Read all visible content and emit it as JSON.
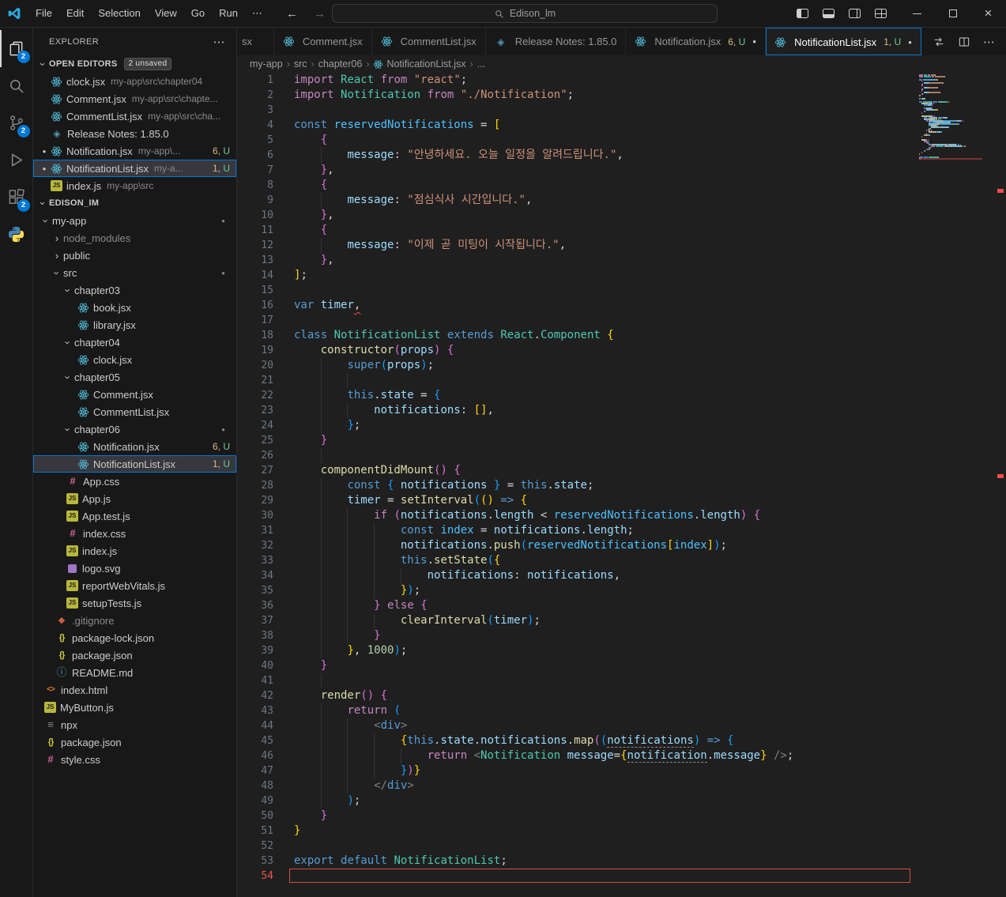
{
  "palette": {
    "accent": "#0078d4",
    "badge": "#0078d4",
    "error": "#f14c4c",
    "untracked": "#73c991",
    "problems": "#d7ba7d"
  },
  "titlebar": {
    "menus": [
      "File",
      "Edit",
      "Selection",
      "View",
      "Go",
      "Run",
      "⋯"
    ],
    "back_arrow": "←",
    "forward_arrow": "→",
    "command_center": "Edison_lm",
    "layout_controls": [
      "toggle-primary-sidebar",
      "toggle-panel",
      "toggle-secondary-sidebar",
      "customize-layout"
    ],
    "window_controls": [
      "minimize",
      "maximize",
      "close"
    ]
  },
  "activity_bar": [
    {
      "name": "explorer",
      "badge": "2",
      "active": true
    },
    {
      "name": "search"
    },
    {
      "name": "source-control",
      "badge": "2"
    },
    {
      "name": "run-debug"
    },
    {
      "name": "extensions",
      "badge": "2"
    },
    {
      "name": "python"
    }
  ],
  "sidebar": {
    "title": "EXPLORER",
    "more": "⋯",
    "open_editors": {
      "label": "OPEN EDITORS",
      "badge": "2 unsaved",
      "items": [
        {
          "icon": "react",
          "label": "clock.jsx",
          "desc": "my-app\\src\\chapter04"
        },
        {
          "icon": "react",
          "label": "Comment.jsx",
          "desc": "my-app\\src\\chapte..."
        },
        {
          "icon": "react",
          "label": "CommentList.jsx",
          "desc": "my-app\\src\\cha..."
        },
        {
          "icon": "notes",
          "label": "Release Notes: 1.85.0"
        },
        {
          "icon": "react",
          "label": "Notification.jsx",
          "desc": "my-app\\...",
          "badge": "6, U",
          "modified": true
        },
        {
          "icon": "react",
          "label": "NotificationList.jsx",
          "desc": "my-a...",
          "badge": "1, U",
          "modified": true,
          "selected": true
        },
        {
          "icon": "js",
          "label": "index.js",
          "desc": "my-app\\src"
        }
      ]
    },
    "workspace": {
      "label": "EDISON_IM",
      "items": [
        {
          "depth": 0,
          "type": "folder",
          "expanded": true,
          "label": "my-app",
          "dot": true
        },
        {
          "depth": 1,
          "type": "folder",
          "label": "node_modules",
          "dim": true
        },
        {
          "depth": 1,
          "type": "folder",
          "label": "public"
        },
        {
          "depth": 1,
          "type": "folder",
          "expanded": true,
          "label": "src",
          "dot": true
        },
        {
          "depth": 2,
          "type": "folder",
          "expanded": true,
          "label": "chapter03"
        },
        {
          "depth": 3,
          "icon": "react",
          "label": "book.jsx"
        },
        {
          "depth": 3,
          "icon": "react",
          "label": "library.jsx"
        },
        {
          "depth": 2,
          "type": "folder",
          "expanded": true,
          "label": "chapter04"
        },
        {
          "depth": 3,
          "icon": "react",
          "label": "clock.jsx"
        },
        {
          "depth": 2,
          "type": "folder",
          "expanded": true,
          "label": "chapter05"
        },
        {
          "depth": 3,
          "icon": "react",
          "label": "Comment.jsx"
        },
        {
          "depth": 3,
          "icon": "react",
          "label": "CommentList.jsx"
        },
        {
          "depth": 2,
          "type": "folder",
          "expanded": true,
          "label": "chapter06",
          "dot": true
        },
        {
          "depth": 3,
          "icon": "react",
          "label": "Notification.jsx",
          "badge": "6, U"
        },
        {
          "depth": 3,
          "icon": "react",
          "label": "NotificationList.jsx",
          "badge": "1, U",
          "selected": true
        },
        {
          "depth": 2,
          "icon": "css",
          "label": "App.css"
        },
        {
          "depth": 2,
          "icon": "js",
          "label": "App.js"
        },
        {
          "depth": 2,
          "icon": "js",
          "label": "App.test.js"
        },
        {
          "depth": 2,
          "icon": "css",
          "label": "index.css"
        },
        {
          "depth": 2,
          "icon": "js",
          "label": "index.js"
        },
        {
          "depth": 2,
          "icon": "svgf",
          "label": "logo.svg"
        },
        {
          "depth": 2,
          "icon": "js",
          "label": "reportWebVitals.js"
        },
        {
          "depth": 2,
          "icon": "js",
          "label": "setupTests.js"
        },
        {
          "depth": 1,
          "icon": "git",
          "label": ".gitignore",
          "dim": true
        },
        {
          "depth": 1,
          "icon": "json",
          "label": "package-lock.json"
        },
        {
          "depth": 1,
          "icon": "json",
          "label": "package.json"
        },
        {
          "depth": 1,
          "icon": "md",
          "label": "README.md"
        },
        {
          "depth": 0,
          "icon": "html",
          "label": "index.html"
        },
        {
          "depth": 0,
          "icon": "js",
          "label": "MyButton.js"
        },
        {
          "depth": 0,
          "icon": "txt",
          "label": "npx"
        },
        {
          "depth": 0,
          "icon": "json",
          "label": "package.json"
        },
        {
          "depth": 0,
          "icon": "css",
          "label": "style.css"
        }
      ]
    }
  },
  "tabs": {
    "items": [
      {
        "label": "sx",
        "partial": true
      },
      {
        "icon": "react",
        "label": "Comment.jsx"
      },
      {
        "icon": "react",
        "label": "CommentList.jsx"
      },
      {
        "icon": "notes",
        "label": "Release Notes: 1.85.0"
      },
      {
        "icon": "react",
        "label": "Notification.jsx",
        "badge": "6, U",
        "modified": true
      },
      {
        "icon": "react",
        "label": "NotificationList.jsx",
        "badge": "1, U",
        "modified": true,
        "active": true
      }
    ],
    "actions": [
      "open-changes",
      "split-editor",
      "more-actions"
    ]
  },
  "breadcrumb": [
    {
      "label": "my-app"
    },
    {
      "label": "src"
    },
    {
      "label": "chapter06"
    },
    {
      "icon": "react",
      "label": "NotificationList.jsx"
    },
    {
      "label": "..."
    }
  ],
  "editor": {
    "error_lines": [
      16,
      54
    ],
    "error_line_box": 54,
    "lines": [
      [
        [
          "kp",
          "import"
        ],
        " ",
        [
          "cl",
          "React"
        ],
        " ",
        [
          "kp",
          "from"
        ],
        " ",
        [
          "st",
          "\"react\""
        ],
        ";"
      ],
      [
        [
          "kp",
          "import"
        ],
        " ",
        [
          "cl",
          "Notification"
        ],
        " ",
        [
          "kp",
          "from"
        ],
        " ",
        [
          "st",
          "\"./Notification\""
        ],
        ";"
      ],
      [],
      [
        [
          "kb",
          "const"
        ],
        " ",
        [
          "ct",
          "reservedNotifications"
        ],
        " = ",
        [
          "b1",
          "["
        ]
      ],
      [
        "    ",
        [
          "b2",
          "{"
        ]
      ],
      [
        "        ",
        [
          "id",
          "message"
        ],
        ": ",
        [
          "st",
          "\"안녕하세요. 오늘 일정을 알려드립니다.\""
        ],
        ","
      ],
      [
        "    ",
        [
          "b2",
          "}"
        ],
        ","
      ],
      [
        "    ",
        [
          "b2",
          "{"
        ]
      ],
      [
        "        ",
        [
          "id",
          "message"
        ],
        ": ",
        [
          "st",
          "\"점심식사 시간입니다.\""
        ],
        ","
      ],
      [
        "    ",
        [
          "b2",
          "}"
        ],
        ","
      ],
      [
        "    ",
        [
          "b2",
          "{"
        ]
      ],
      [
        "        ",
        [
          "id",
          "message"
        ],
        ": ",
        [
          "st",
          "\"이제 곧 미팅이 시작됩니다.\""
        ],
        ","
      ],
      [
        "    ",
        [
          "b2",
          "}"
        ],
        ","
      ],
      [
        [
          "b1",
          "]"
        ],
        ";"
      ],
      [],
      [
        [
          "kb",
          "var"
        ],
        " ",
        [
          "id",
          "timer"
        ],
        [
          "er",
          ","
        ]
      ],
      [],
      [
        [
          "kb",
          "class"
        ],
        " ",
        [
          "cl",
          "NotificationList"
        ],
        " ",
        [
          "kb",
          "extends"
        ],
        " ",
        [
          "cl",
          "React"
        ],
        ".",
        [
          "cl",
          "Component"
        ],
        " ",
        [
          "b1",
          "{"
        ]
      ],
      [
        "    ",
        [
          "fn",
          "constructor"
        ],
        [
          "b2",
          "("
        ],
        [
          "id",
          "props"
        ],
        [
          "b2",
          ")"
        ],
        " ",
        [
          "b2",
          "{"
        ]
      ],
      [
        "        ",
        [
          "kb",
          "super"
        ],
        [
          "b3",
          "("
        ],
        [
          "id",
          "props"
        ],
        [
          "b3",
          ")"
        ],
        ";"
      ],
      [],
      [
        "        ",
        [
          "kb",
          "this"
        ],
        ".",
        [
          "id",
          "state"
        ],
        " = ",
        [
          "b3",
          "{"
        ]
      ],
      [
        "            ",
        [
          "id",
          "notifications"
        ],
        ": ",
        [
          "b1",
          "[]"
        ],
        ","
      ],
      [
        "        ",
        [
          "b3",
          "}"
        ],
        ";"
      ],
      [
        "    ",
        [
          "b2",
          "}"
        ]
      ],
      [],
      [
        "    ",
        [
          "fn",
          "componentDidMount"
        ],
        [
          "b2",
          "()"
        ],
        " ",
        [
          "b2",
          "{"
        ]
      ],
      [
        "        ",
        [
          "kb",
          "const"
        ],
        " ",
        [
          "b3",
          "{"
        ],
        " ",
        [
          "id",
          "notifications"
        ],
        " ",
        [
          "b3",
          "}"
        ],
        " = ",
        [
          "kb",
          "this"
        ],
        ".",
        [
          "id",
          "state"
        ],
        ";"
      ],
      [
        "        ",
        [
          "id",
          "timer"
        ],
        " = ",
        [
          "fn",
          "setInterval"
        ],
        [
          "b3",
          "("
        ],
        [
          "b1",
          "()"
        ],
        " ",
        [
          "kb",
          "=>"
        ],
        " ",
        [
          "b1",
          "{"
        ]
      ],
      [
        "            ",
        [
          "kp",
          "if"
        ],
        " ",
        [
          "b2",
          "("
        ],
        [
          "id",
          "notifications"
        ],
        ".",
        [
          "id",
          "length"
        ],
        " < ",
        [
          "ct",
          "reservedNotifications"
        ],
        ".",
        [
          "id",
          "length"
        ],
        [
          "b2",
          ")"
        ],
        " ",
        [
          "b2",
          "{"
        ]
      ],
      [
        "                ",
        [
          "kb",
          "const"
        ],
        " ",
        [
          "ct",
          "index"
        ],
        " = ",
        [
          "id",
          "notifications"
        ],
        ".",
        [
          "id",
          "length"
        ],
        ";"
      ],
      [
        "                ",
        [
          "id",
          "notifications"
        ],
        ".",
        [
          "fn",
          "push"
        ],
        [
          "b3",
          "("
        ],
        [
          "ct",
          "reservedNotifications"
        ],
        [
          "b1",
          "["
        ],
        [
          "ct",
          "index"
        ],
        [
          "b1",
          "]"
        ],
        [
          "b3",
          ")"
        ],
        ";"
      ],
      [
        "                ",
        [
          "kb",
          "this"
        ],
        ".",
        [
          "fn",
          "setState"
        ],
        [
          "b3",
          "("
        ],
        [
          "b1",
          "{"
        ]
      ],
      [
        "                    ",
        [
          "id",
          "notifications"
        ],
        ": ",
        [
          "id",
          "notifications"
        ],
        ","
      ],
      [
        "                ",
        [
          "b1",
          "}"
        ],
        [
          "b3",
          ")"
        ],
        ";"
      ],
      [
        "            ",
        [
          "b2",
          "}"
        ],
        " ",
        [
          "kp",
          "else"
        ],
        " ",
        [
          "b2",
          "{"
        ]
      ],
      [
        "                ",
        [
          "fn",
          "clearInterval"
        ],
        [
          "b3",
          "("
        ],
        [
          "id",
          "timer"
        ],
        [
          "b3",
          ")"
        ],
        ";"
      ],
      [
        "            ",
        [
          "b2",
          "}"
        ]
      ],
      [
        "        ",
        [
          "b1",
          "}"
        ],
        ", ",
        [
          "nm",
          "1000"
        ],
        [
          "b3",
          ")"
        ],
        ";"
      ],
      [
        "    ",
        [
          "b2",
          "}"
        ]
      ],
      [],
      [
        "    ",
        [
          "fn",
          "render"
        ],
        [
          "b2",
          "()"
        ],
        " ",
        [
          "b2",
          "{"
        ]
      ],
      [
        "        ",
        [
          "kp",
          "return"
        ],
        " ",
        [
          "b3",
          "("
        ]
      ],
      [
        "            ",
        [
          "an",
          "<"
        ],
        [
          "tg",
          "div"
        ],
        [
          "an",
          ">"
        ]
      ],
      [
        "                ",
        [
          "b1",
          "{"
        ],
        [
          "kb",
          "this"
        ],
        ".",
        [
          "id",
          "state"
        ],
        ".",
        [
          "id",
          "notifications"
        ],
        ".",
        [
          "fn",
          "map"
        ],
        [
          "b2",
          "("
        ],
        [
          "b3",
          "("
        ],
        [
          "un",
          "notifications"
        ],
        [
          "b3",
          ")"
        ],
        " ",
        [
          "kb",
          "=>"
        ],
        " ",
        [
          "b3",
          "{"
        ]
      ],
      [
        "                    ",
        [
          "kp",
          "return"
        ],
        " ",
        [
          "an",
          "<"
        ],
        [
          "cl",
          "Notification"
        ],
        " ",
        [
          "id",
          "message"
        ],
        "=",
        [
          "b1",
          "{"
        ],
        [
          "un",
          "notification"
        ],
        ".",
        [
          "id",
          "message"
        ],
        [
          "b1",
          "}"
        ],
        " ",
        [
          "an",
          "/>"
        ],
        ";"
      ],
      [
        "                ",
        [
          "b3",
          "}"
        ],
        [
          "b2",
          ")"
        ],
        [
          "b1",
          "}"
        ]
      ],
      [
        "            ",
        [
          "an",
          "</"
        ],
        [
          "tg",
          "div"
        ],
        [
          "an",
          ">"
        ]
      ],
      [
        "        ",
        [
          "b3",
          ")"
        ],
        ";"
      ],
      [
        "    ",
        [
          "b2",
          "}"
        ]
      ],
      [
        [
          "b1",
          "}"
        ]
      ],
      [],
      [
        [
          "kb",
          "export"
        ],
        " ",
        [
          "kb",
          "default"
        ],
        " ",
        [
          "cl",
          "NotificationList"
        ],
        ";"
      ],
      []
    ]
  }
}
